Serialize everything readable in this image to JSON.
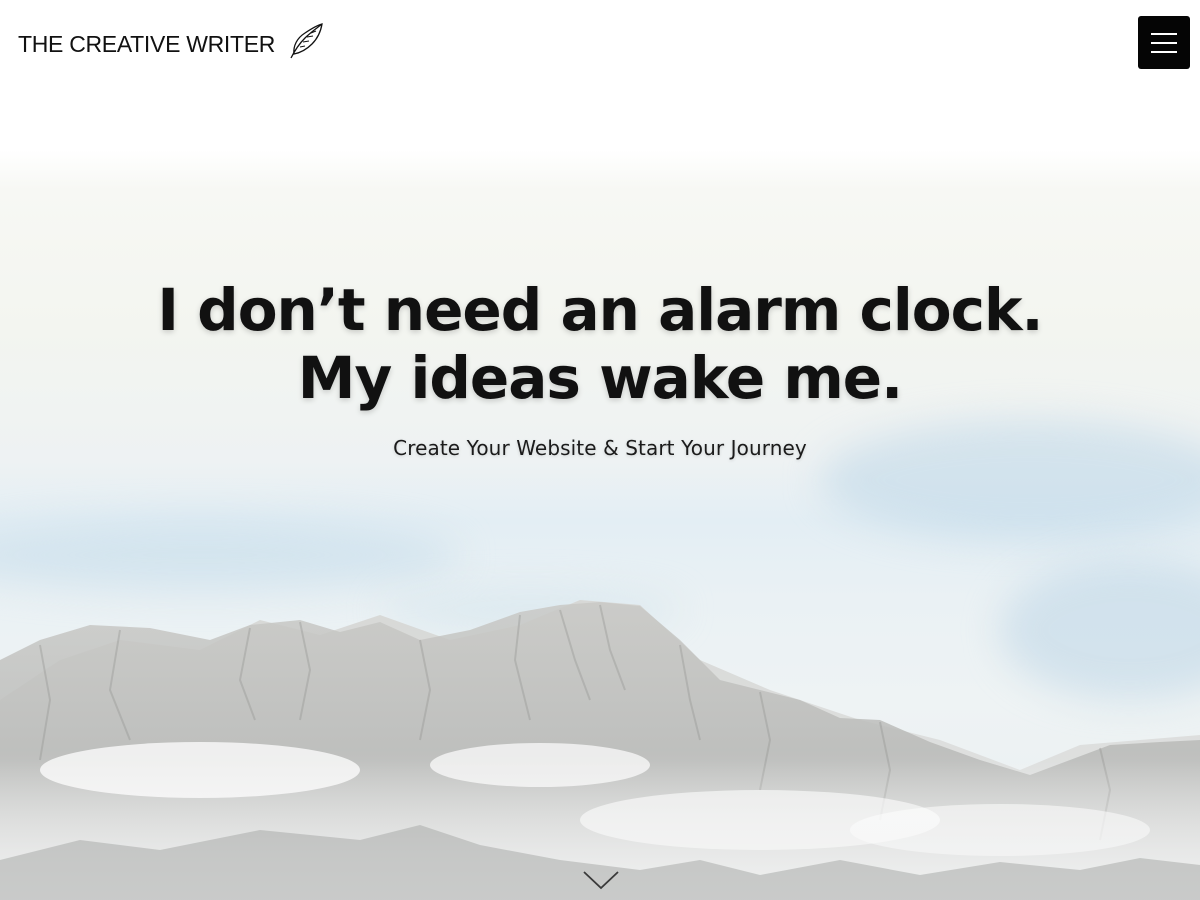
{
  "header": {
    "logo_text": "THE CREATIVE WRITER",
    "logo_icon": "feather-icon",
    "menu_icon": "hamburger-menu-icon"
  },
  "hero": {
    "title_line1": "I don’t need an alarm clock.",
    "title_line2": "My ideas wake me.",
    "subtitle": "Create Your Website & Start Your Journey",
    "scroll_icon": "chevron-down-icon"
  },
  "colors": {
    "text": "#111111",
    "menu_button_bg": "#050505",
    "menu_button_lines": "#ffffff",
    "sky": "#e3eef4"
  }
}
